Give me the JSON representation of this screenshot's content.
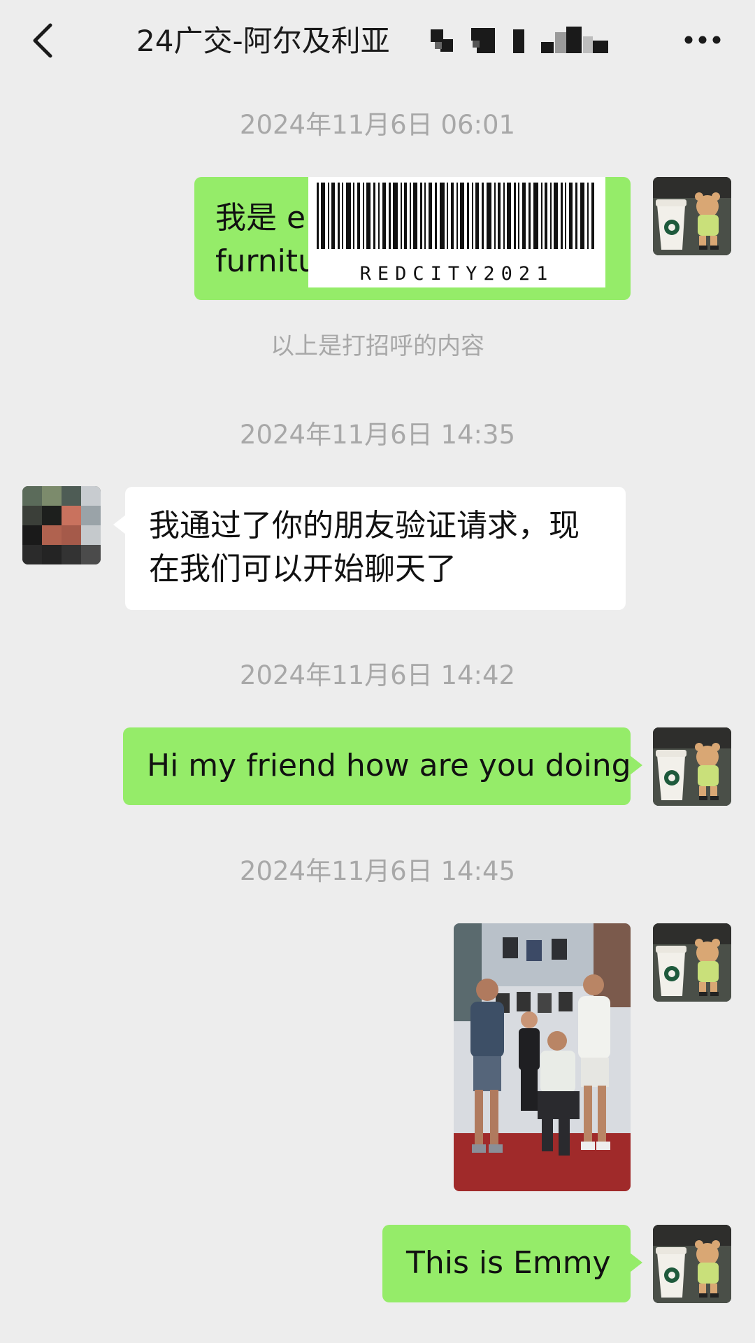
{
  "header": {
    "back_icon": "chevron-left-icon",
    "title": "24广交-阿尔及利亚",
    "more_icon": "more-dots-icon"
  },
  "messages": [
    {
      "type": "timestamp",
      "text": "2024年11月6日 06:01"
    },
    {
      "type": "text",
      "sender": "self",
      "lines": [
        "我是 er",
        "furnitu"
      ],
      "sticker_text": "REDCITY2021"
    },
    {
      "type": "system",
      "text": "以上是打招呼的内容"
    },
    {
      "type": "timestamp",
      "text": "2024年11月6日 14:35"
    },
    {
      "type": "text",
      "sender": "other",
      "lines": [
        "我通过了你的朋友验证请求，现",
        "在我们可以开始聊天了"
      ]
    },
    {
      "type": "timestamp",
      "text": "2024年11月6日 14:42"
    },
    {
      "type": "text",
      "sender": "self",
      "text": "Hi my friend how are you doing"
    },
    {
      "type": "timestamp",
      "text": "2024年11月6日 14:45"
    },
    {
      "type": "image",
      "sender": "self",
      "description_icon": "photo-people-in-chair-showroom"
    },
    {
      "type": "text",
      "sender": "self",
      "text": "This is Emmy"
    }
  ],
  "colors": {
    "background": "#ededed",
    "self_bubble": "#95ec69",
    "other_bubble": "#ffffff",
    "timestamp": "#a8a8a8"
  }
}
